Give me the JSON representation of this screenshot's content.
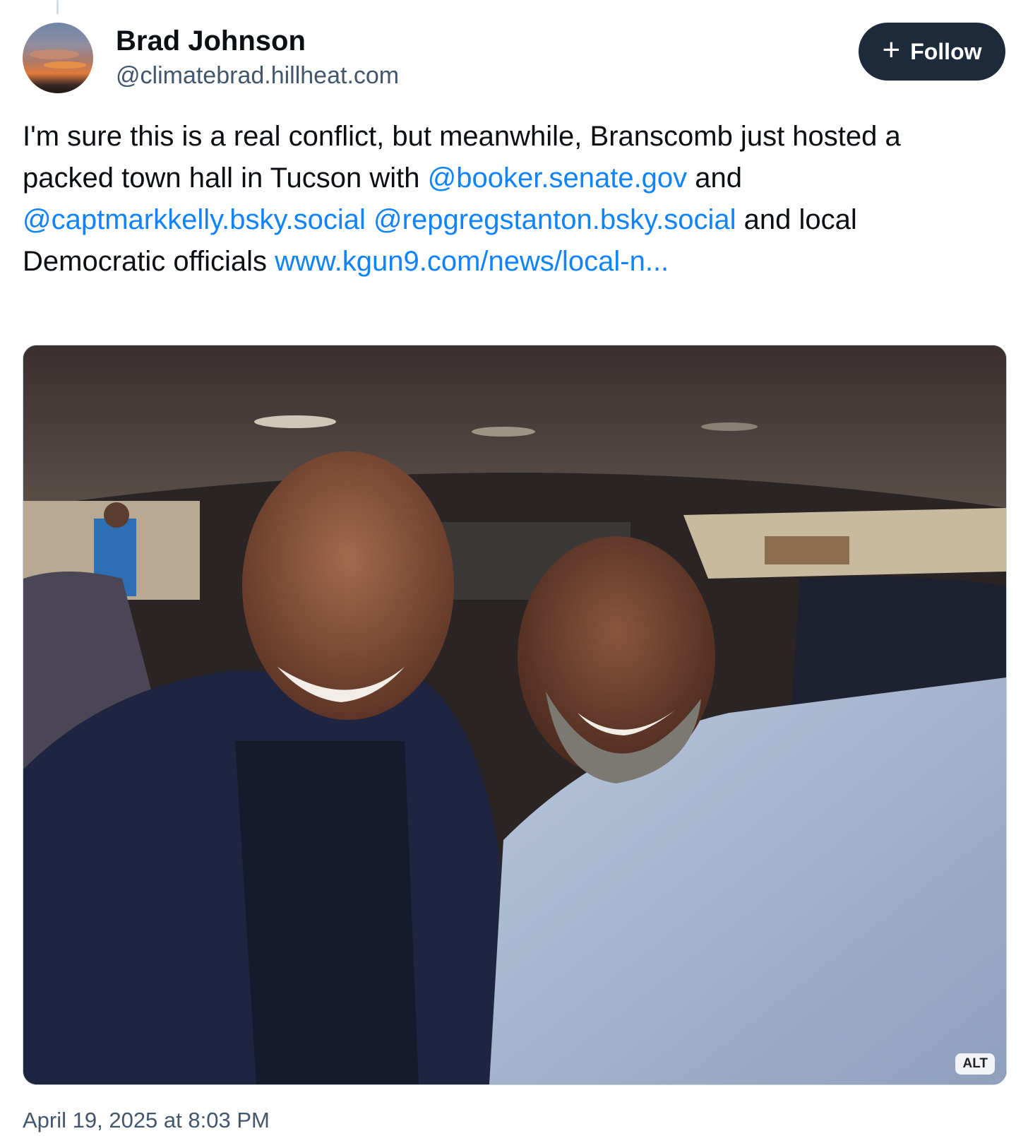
{
  "author": {
    "display_name": "Brad Johnson",
    "handle": "@climatebrad.hillheat.com"
  },
  "follow_button": {
    "icon": "plus-icon",
    "label": "Follow"
  },
  "post": {
    "text_1": "I'm sure this is a real conflict, but meanwhile, Branscomb just hosted a packed town hall in Tucson with ",
    "mention_1": "@booker.senate.gov",
    "text_2": " and ",
    "mention_2": "@captmarkkelly.bsky.social",
    "text_3": " ",
    "mention_3": "@repgregstanton.bsky.social",
    "text_4": " and local Democratic officials ",
    "link": "www.kgun9.com/news/local-n..."
  },
  "image": {
    "alt_badge": "ALT"
  },
  "timestamp": "April 19, 2025 at 8:03 PM",
  "colors": {
    "link": "#1083fe",
    "follow_button_bg": "#1d2a3a",
    "secondary_text": "#42576c"
  }
}
